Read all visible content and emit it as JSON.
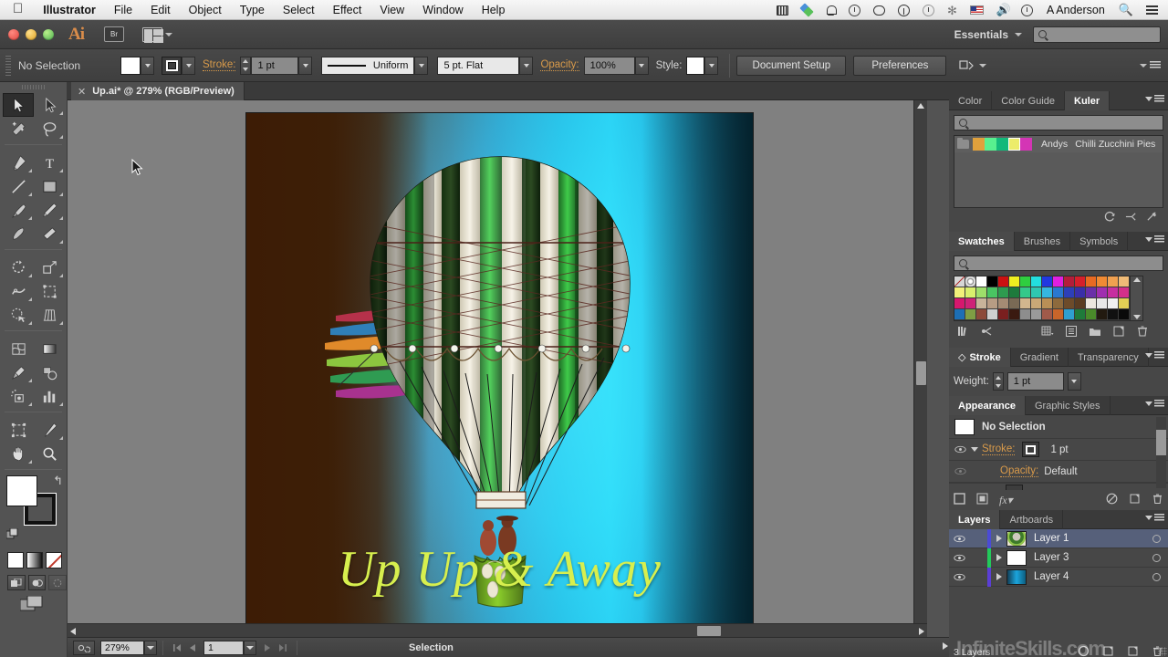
{
  "os_menu": {
    "apple_icon": "apple-icon",
    "items": [
      "Illustrator",
      "File",
      "Edit",
      "Object",
      "Type",
      "Select",
      "Effect",
      "View",
      "Window",
      "Help"
    ],
    "right_icons": [
      "film-icon",
      "dropbox-icon",
      "bell-icon",
      "timemachine-icon",
      "chat-icon",
      "accessibility-icon",
      "history-icon",
      "bluetooth-icon",
      "flag-icon",
      "volume-icon",
      "clock-icon"
    ],
    "user": "A Anderson",
    "search_icon": "search-icon",
    "list_icon": "notification-center-icon"
  },
  "titlebar": {
    "app_logo": "Ai",
    "bridge_label": "Br",
    "arrange_icon": "arrange-documents-icon",
    "workspace": "Essentials",
    "workspace_caret": "chevron-down-icon",
    "search_placeholder": "",
    "search_icon": "search-icon"
  },
  "control_bar": {
    "selection_state": "No Selection",
    "fill_swatch_color": "#ffffff",
    "stroke_swatch_icon": "stroke-swatch-icon",
    "stroke_label": "Stroke:",
    "stroke_weight": "1 pt",
    "profile_value": "Uniform",
    "brush_value": "5 pt. Flat",
    "opacity_label": "Opacity:",
    "opacity_value": "100%",
    "style_label": "Style:",
    "style_swatch_color": "#ffffff",
    "document_setup": "Document Setup",
    "preferences": "Preferences",
    "align_icon": "align-to-pixel-grid-icon",
    "panel_menu_icon": "panel-menu-icon"
  },
  "document_tab": {
    "close_icon": "close-icon",
    "title": "Up.ai* @ 279% (RGB/Preview)"
  },
  "toolbar": {
    "tools": [
      {
        "name": "selection-tool",
        "selected": true
      },
      {
        "name": "direct-selection-tool",
        "selected": false
      },
      {
        "name": "magic-wand-tool",
        "selected": false
      },
      {
        "name": "lasso-tool",
        "selected": false
      },
      {
        "name": "pen-tool",
        "selected": false
      },
      {
        "name": "type-tool",
        "selected": false
      },
      {
        "name": "line-segment-tool",
        "selected": false
      },
      {
        "name": "rectangle-tool",
        "selected": false
      },
      {
        "name": "paintbrush-tool",
        "selected": false
      },
      {
        "name": "pencil-tool",
        "selected": false
      },
      {
        "name": "blob-brush-tool",
        "selected": false
      },
      {
        "name": "eraser-tool",
        "selected": false
      },
      {
        "name": "rotate-tool",
        "selected": false
      },
      {
        "name": "scale-tool",
        "selected": false
      },
      {
        "name": "width-tool",
        "selected": false
      },
      {
        "name": "free-transform-tool",
        "selected": false
      },
      {
        "name": "shape-builder-tool",
        "selected": false
      },
      {
        "name": "perspective-grid-tool",
        "selected": false
      },
      {
        "name": "mesh-tool",
        "selected": false
      },
      {
        "name": "gradient-tool",
        "selected": false
      },
      {
        "name": "eyedropper-tool",
        "selected": false
      },
      {
        "name": "blend-tool",
        "selected": false
      },
      {
        "name": "symbol-sprayer-tool",
        "selected": false
      },
      {
        "name": "column-graph-tool",
        "selected": false
      },
      {
        "name": "artboard-tool",
        "selected": false
      },
      {
        "name": "slice-tool",
        "selected": false
      },
      {
        "name": "hand-tool",
        "selected": false
      },
      {
        "name": "zoom-tool",
        "selected": false
      }
    ],
    "fill_color": "#ffffff",
    "stroke_color": "#000000",
    "swap_icon": "swap-fill-stroke-icon",
    "default_icon": "default-fill-stroke-icon",
    "paint_modes": [
      "color-mode-icon",
      "gradient-mode-icon",
      "none-mode-icon"
    ],
    "draw_modes": [
      "draw-normal-icon",
      "draw-behind-icon",
      "draw-inside-icon"
    ],
    "screen_mode_icon": "change-screen-mode-icon"
  },
  "panels": {
    "color_group": {
      "tabs": [
        {
          "label": "Color",
          "active": false
        },
        {
          "label": "Color Guide",
          "active": false
        },
        {
          "label": "Kuler",
          "active": true
        }
      ],
      "search_placeholder": "",
      "theme": {
        "folder_icon": "folder-icon",
        "swatches": [
          "#e0a13c",
          "#58f08f",
          "#13b97a",
          "#ecec6a",
          "#d435b5"
        ],
        "selected_swatch_index": 3,
        "author": "Andys",
        "name": "Chilli Zucchini Pies"
      },
      "footer_icons": [
        "refresh-icon",
        "edit-in-kuler-icon",
        "add-to-swatches-icon"
      ]
    },
    "swatches_group": {
      "tabs": [
        {
          "label": "Swatches",
          "active": true
        },
        {
          "label": "Brushes",
          "active": false
        },
        {
          "label": "Symbols",
          "active": false
        }
      ],
      "search_placeholder": "",
      "grid_rows": [
        [
          "#9e3b2e",
          "#8c8c8c",
          "#ffffff",
          "#000000",
          "#cc1111",
          "#f0ee20",
          "#2fce3f",
          "#23dede",
          "#2139e0",
          "#e020e0",
          "#b41d3a",
          "#d6202b",
          "#e86a22",
          "#f08a33",
          "#f0a050",
          "#efbb77"
        ],
        [
          "#f2f07a",
          "#d9ef6d",
          "#9ede6a",
          "#49c462",
          "#2e9b4f",
          "#1d7a3c",
          "#34c98a",
          "#2fc7b0",
          "#36b6e0",
          "#2a78d0",
          "#2d3fb8",
          "#3a2fa8",
          "#6a2fa8",
          "#a02fb0",
          "#c72fa0",
          "#d42f8a"
        ],
        [
          "#d6176e",
          "#ce2277",
          "#c8b49a",
          "#b79c84",
          "#a58b74",
          "#7a6a55",
          "#d2b68e",
          "#c9a877",
          "#b98f56",
          "#8d6a3d",
          "#6d4b2a",
          "#5a3c22",
          "#ece7df",
          "#e8e8e8",
          "#f0f0f0",
          "#e2cf55"
        ],
        [
          "#1d6fb5",
          "#7f9e44",
          "#8c4a3a",
          "#cfcfcf",
          "#7a1f1f",
          "#3a1a10",
          "#8d8d8d",
          "#9a9a9a",
          "#a05a4a",
          "#c8652a",
          "#2f9fd0",
          "#1f7a3a",
          "#4a8a2a",
          "#221a10",
          "#111111",
          "#0a0a0a"
        ]
      ],
      "footer_icons": [
        "swatch-libraries-icon",
        "color-group-link-icon",
        "show-swatch-kinds-icon",
        "swatch-options-icon",
        "new-color-group-icon",
        "new-swatch-icon",
        "delete-swatch-icon"
      ]
    },
    "stroke_group": {
      "tabs": [
        {
          "label": "Stroke",
          "active": true
        },
        {
          "label": "Gradient",
          "active": false
        },
        {
          "label": "Transparency",
          "active": false
        }
      ],
      "weight_label": "Weight:",
      "weight_value": "1 pt"
    },
    "appearance_group": {
      "tabs": [
        {
          "label": "Appearance",
          "active": true
        },
        {
          "label": "Graphic Styles",
          "active": false
        }
      ],
      "header": "No Selection",
      "rows": [
        {
          "label": "Stroke:",
          "value": "1 pt",
          "eye": true,
          "disclosure": true
        },
        {
          "label": "Opacity:",
          "value": "Default",
          "eye": true,
          "disclosure": false
        }
      ],
      "footer_icons": [
        "add-new-stroke-icon",
        "add-new-fill-icon",
        "add-new-effect-icon",
        "clear-appearance-icon",
        "duplicate-item-icon",
        "delete-item-icon"
      ]
    },
    "layers_group": {
      "tabs": [
        {
          "label": "Layers",
          "active": true
        },
        {
          "label": "Artboards",
          "active": false
        }
      ],
      "rows": [
        {
          "name": "Layer 1",
          "color": "#4b4bd6",
          "selected": true,
          "thumb": "balloon-thumbnail"
        },
        {
          "name": "Layer 3",
          "color": "#22c95a",
          "selected": false,
          "thumb": "white-thumbnail"
        },
        {
          "name": "Layer 4",
          "color": "#5b3ed6",
          "selected": false,
          "thumb": "gradient-thumbnail"
        }
      ],
      "count_label": "3 Layers",
      "footer_icons": [
        "make-clipping-mask-icon",
        "create-new-sublayer-icon",
        "create-new-layer-icon",
        "delete-layer-icon"
      ],
      "watermark": "InfiniteSkills.com"
    }
  },
  "status_bar": {
    "zoom_value": "279%",
    "artboard_value": "1",
    "status_text": "Selection",
    "first_icon": "artboard-nav-first-icon",
    "prev_icon": "artboard-nav-prev-icon",
    "next_icon": "artboard-nav-next-icon",
    "last_icon": "artboard-nav-last-icon"
  },
  "artwork": {
    "headline": "Up Up & Away",
    "headline_color": "#d7ef4e",
    "background_colors": [
      "#3d1c05",
      "#1aa0d8",
      "#06303f"
    ],
    "balloon_stripe_colors": [
      "#2fae42",
      "#efeadc",
      "#2a4d1f"
    ],
    "basket_color": "#7fc12a",
    "streamer_colors": [
      "#c0392b",
      "#2e86c1",
      "#e8902a",
      "#8dc63f",
      "#2e9b4f",
      "#b0318f"
    ]
  }
}
